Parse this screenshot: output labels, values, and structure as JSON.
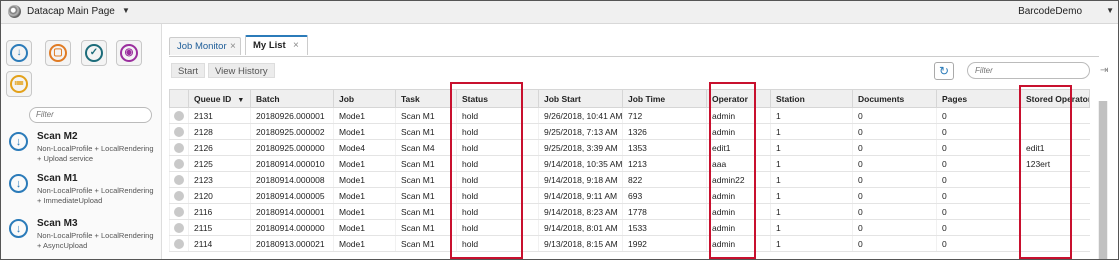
{
  "topbar": {
    "title": "Datacap Main Page",
    "user": "BarcodeDemo"
  },
  "left": {
    "action_buttons": [
      {
        "name": "download-icon",
        "glyph": "↓",
        "color": "#2b7bb9"
      },
      {
        "name": "document-icon",
        "glyph": "▢",
        "color": "#e07b24"
      },
      {
        "name": "check-icon",
        "glyph": "✓",
        "color": "#1c6c7a"
      },
      {
        "name": "eye-icon",
        "glyph": "◉",
        "color": "#9b2f9e"
      },
      {
        "name": "list-icon",
        "glyph": "≔",
        "color": "#e3a11a"
      }
    ],
    "filter_placeholder": "Filter",
    "tasks": [
      {
        "name": "Scan M2",
        "desc": "Non-LocalProfile + LocalRendering + Upload service"
      },
      {
        "name": "Scan M1",
        "desc": "Non-LocalProfile + LocalRendering + ImmediateUpload"
      },
      {
        "name": "Scan M3",
        "desc": "Non-LocalProfile + LocalRendering + AsyncUpload"
      }
    ]
  },
  "tabs": [
    {
      "label": "Job Monitor"
    },
    {
      "label": "My List"
    }
  ],
  "toolbar": {
    "start_label": "Start",
    "history_label": "View History",
    "filter_placeholder": "Filter"
  },
  "table": {
    "columns": [
      "",
      "Queue ID",
      "Batch",
      "Job",
      "Task",
      "Status",
      "Job Start",
      "Job Time",
      "Operator",
      "Station",
      "Documents",
      "Pages",
      "Stored Operator"
    ],
    "rows": [
      [
        "2131",
        "20180926.000001",
        "Mode1",
        "Scan M1",
        "hold",
        "9/26/2018, 10:41 AM",
        "712",
        "admin",
        "1",
        "0",
        "0",
        ""
      ],
      [
        "2128",
        "20180925.000002",
        "Mode1",
        "Scan M1",
        "hold",
        "9/25/2018, 7:13 AM",
        "1326",
        "admin",
        "1",
        "0",
        "0",
        ""
      ],
      [
        "2126",
        "20180925.000000",
        "Mode4",
        "Scan M4",
        "hold",
        "9/25/2018, 3:39 AM",
        "1353",
        "edit1",
        "1",
        "0",
        "0",
        "edit1"
      ],
      [
        "2125",
        "20180914.000010",
        "Mode1",
        "Scan M1",
        "hold",
        "9/14/2018, 10:35 AM",
        "1213",
        "aaa",
        "1",
        "0",
        "0",
        "123ert"
      ],
      [
        "2123",
        "20180914.000008",
        "Mode1",
        "Scan M1",
        "hold",
        "9/14/2018, 9:18 AM",
        "822",
        "admin22",
        "1",
        "0",
        "0",
        ""
      ],
      [
        "2120",
        "20180914.000005",
        "Mode1",
        "Scan M1",
        "hold",
        "9/14/2018, 9:11 AM",
        "693",
        "admin",
        "1",
        "0",
        "0",
        ""
      ],
      [
        "2116",
        "20180914.000001",
        "Mode1",
        "Scan M1",
        "hold",
        "9/14/2018, 8:23 AM",
        "1778",
        "admin",
        "1",
        "0",
        "0",
        ""
      ],
      [
        "2115",
        "20180914.000000",
        "Mode1",
        "Scan M1",
        "hold",
        "9/14/2018, 8:01 AM",
        "1533",
        "admin",
        "1",
        "0",
        "0",
        ""
      ],
      [
        "2114",
        "20180913.000021",
        "Mode1",
        "Scan M1",
        "hold",
        "9/13/2018, 8:15 AM",
        "1992",
        "admin",
        "1",
        "0",
        "0",
        ""
      ]
    ]
  }
}
